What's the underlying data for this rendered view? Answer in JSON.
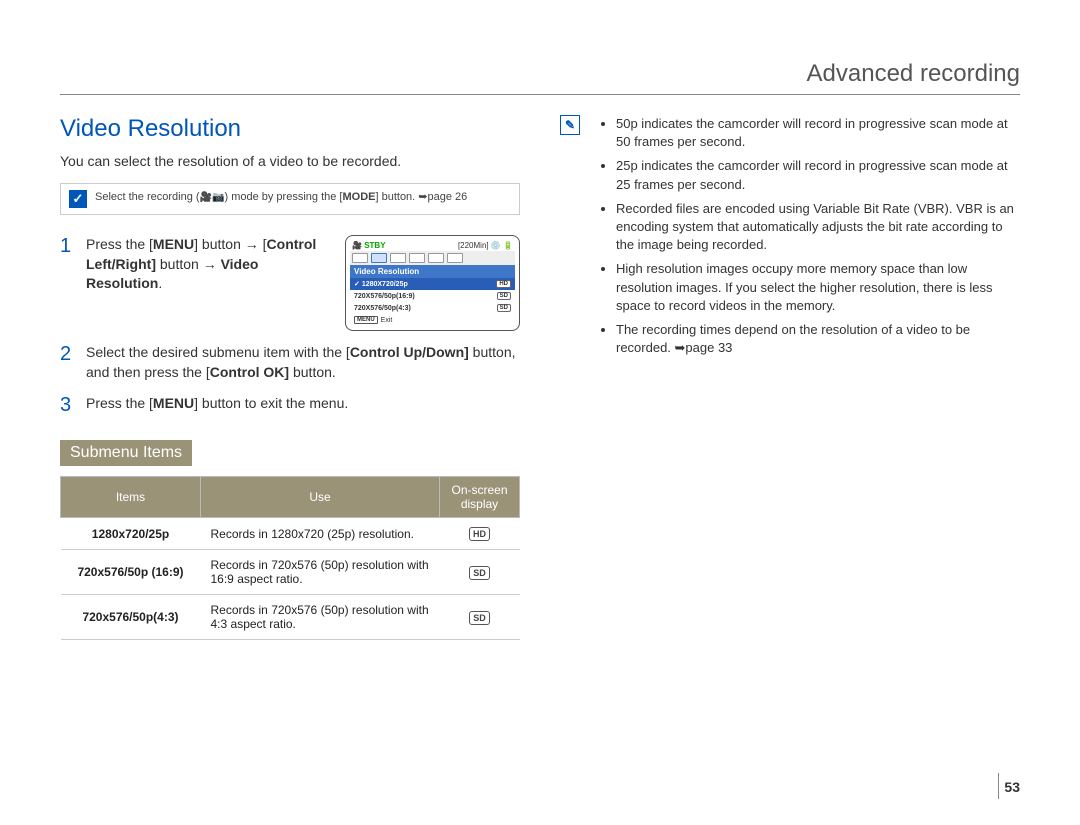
{
  "header": {
    "title": "Advanced recording"
  },
  "section": {
    "title": "Video Resolution",
    "intro": "You can select the resolution of a video to be recorded."
  },
  "mode_note": {
    "pre": "Select the recording (",
    "post": ") mode by pressing the [",
    "mode_btn": "MODE",
    "tail": "] button. ➥page 26"
  },
  "steps": [
    {
      "num": "1",
      "parts": [
        "Press the [",
        "MENU",
        "] button → ",
        "[",
        "Control Left/Right]",
        " button → ",
        "Video Resolution",
        "."
      ]
    },
    {
      "num": "2",
      "parts": [
        "Select the desired submenu item with the [",
        "Control Up/Down]",
        " button, and then press the [",
        "Control OK]",
        " button."
      ]
    },
    {
      "num": "3",
      "parts": [
        "Press the [",
        "MENU",
        "] button to exit the menu."
      ]
    }
  ],
  "lcd": {
    "stby": "STBY",
    "time": "[220Min]",
    "menu_title": "Video Resolution",
    "options": [
      {
        "label": "1280X720/25p",
        "badge": "HD",
        "selected": true
      },
      {
        "label": "720X576/50p(16:9)",
        "badge": "SD",
        "selected": false
      },
      {
        "label": "720X576/50p(4:3)",
        "badge": "SD",
        "selected": false
      }
    ],
    "exit_btn": "MENU",
    "exit": "Exit"
  },
  "submenu": {
    "heading": "Submenu Items",
    "headers": {
      "items": "Items",
      "use": "Use",
      "display": "On-screen display"
    },
    "rows": [
      {
        "item": "1280x720/25p",
        "use": "Records in 1280x720 (25p) resolution.",
        "badge": "HD"
      },
      {
        "item": "720x576/50p (16:9)",
        "use": "Records in 720x576 (50p) resolution with 16:9 aspect ratio.",
        "badge": "SD"
      },
      {
        "item": "720x576/50p(4:3)",
        "use": "Records in 720x576 (50p) resolution with 4:3 aspect ratio.",
        "badge": "SD"
      }
    ]
  },
  "notes": [
    "50p indicates the camcorder will record in progressive scan mode at 50 frames per second.",
    "25p indicates the camcorder will record in progressive scan mode at 25 frames per second.",
    "Recorded files are encoded using Variable Bit Rate (VBR). VBR is an encoding system that automatically adjusts the bit rate according to the image being recorded.",
    "High resolution images occupy more memory space than low resolution images. If you select the higher resolution, there is less space to record videos in the memory.",
    "The recording times depend on the resolution of a video to be recorded. ➥page 33"
  ],
  "page_number": "53"
}
